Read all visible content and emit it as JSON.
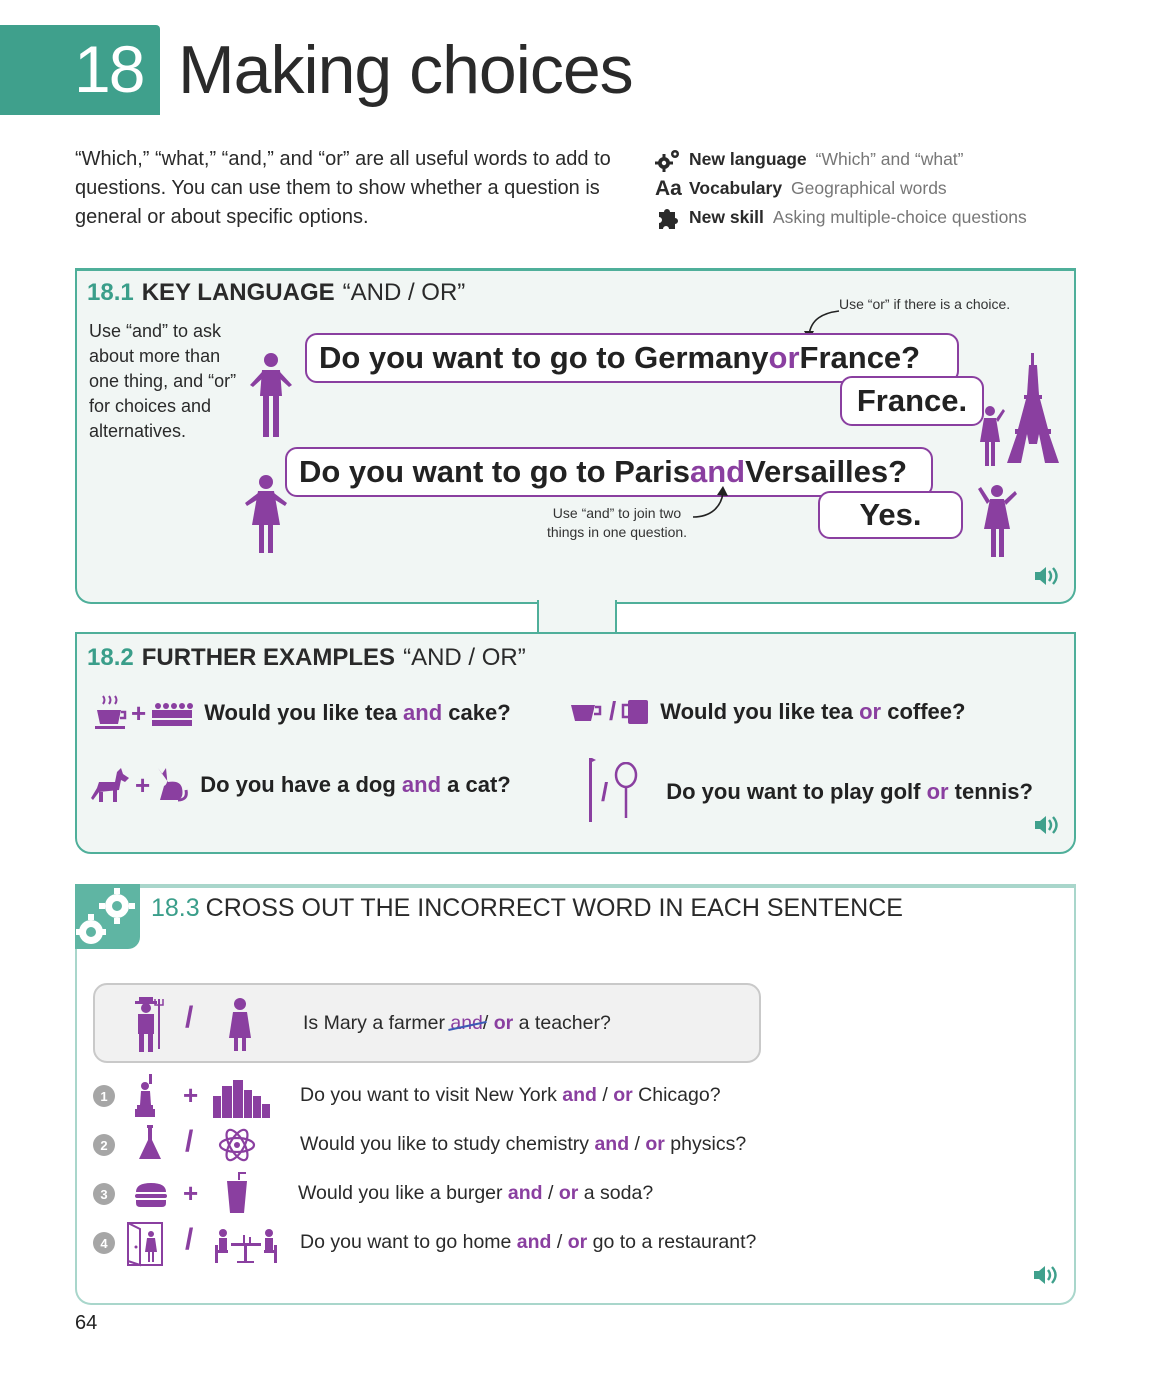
{
  "header": {
    "chapter_number": "18",
    "title": "Making choices"
  },
  "intro": "“Which,” “what,” “and,” and “or” are all useful words to add to questions. You can use them to show whether a question is general or about specific options.",
  "meta": [
    {
      "icon": "gears-icon",
      "label": "New language",
      "value": "“Which” and “what”"
    },
    {
      "icon": "aa-icon",
      "label": "Vocabulary",
      "value": "Geographical words"
    },
    {
      "icon": "puzzle-icon",
      "label": "New skill",
      "value": "Asking multiple-choice questions"
    }
  ],
  "s181": {
    "number": "18.1",
    "title": "KEY LANGUAGE",
    "subtitle": "“AND / OR”",
    "side_note": "Use “and” to ask about more than one thing, and “or” for choices and alternatives.",
    "note_or": "Use “or” if there is a choice.",
    "note_and": "Use “and” to join two things in one question.",
    "q1_a": "Do you want to go to Germany ",
    "q1_op": "or",
    "q1_b": " France?",
    "a1": "France.",
    "q2_a": "Do you want to go to Paris ",
    "q2_op": "and",
    "q2_b": " Versailles?",
    "a2": "Yes."
  },
  "s182": {
    "number": "18.2",
    "title": "FURTHER EXAMPLES",
    "subtitle": "“AND / OR”",
    "examples": [
      {
        "a": "Would you like tea ",
        "op": "and",
        "b": " cake?",
        "sym": "+"
      },
      {
        "a": "Would you like tea ",
        "op": "or",
        "b": " coffee?",
        "sym": "/"
      },
      {
        "a": "Do you have a dog ",
        "op": "and",
        "b": " a cat?",
        "sym": "+"
      },
      {
        "a": "Do you want to play golf ",
        "op": "or",
        "b": " tennis?",
        "sym": "/"
      }
    ]
  },
  "s183": {
    "number": "18.3",
    "title": "CROSS OUT THE INCORRECT WORD IN EACH SENTENCE",
    "example": {
      "a": "Is Mary a farmer ",
      "struck": "and",
      "mid": "/ ",
      "op": "or",
      "b": " a teacher?",
      "sym": "/"
    },
    "questions": [
      {
        "num": "1",
        "sym": "+",
        "a": "Do you want to visit New York ",
        "and": "and",
        "sep": " / ",
        "or": "or",
        "b": " Chicago?"
      },
      {
        "num": "2",
        "sym": "/",
        "a": "Would you like to study chemistry ",
        "and": "and",
        "sep": " / ",
        "or": "or",
        "b": " physics?"
      },
      {
        "num": "3",
        "sym": "+",
        "a": "Would you like a burger ",
        "and": "and",
        "sep": " / ",
        "or": "or",
        "b": " a soda?"
      },
      {
        "num": "4",
        "sym": "/",
        "a": "Do you want to go home ",
        "and": "and",
        "sep": " / ",
        "or": "or",
        "b": " go to a restaurant?"
      }
    ]
  },
  "page_number": "64",
  "colors": {
    "teal": "#3fa08c",
    "purple": "#8a3fa0",
    "panel_bg": "#f1f6f4"
  }
}
